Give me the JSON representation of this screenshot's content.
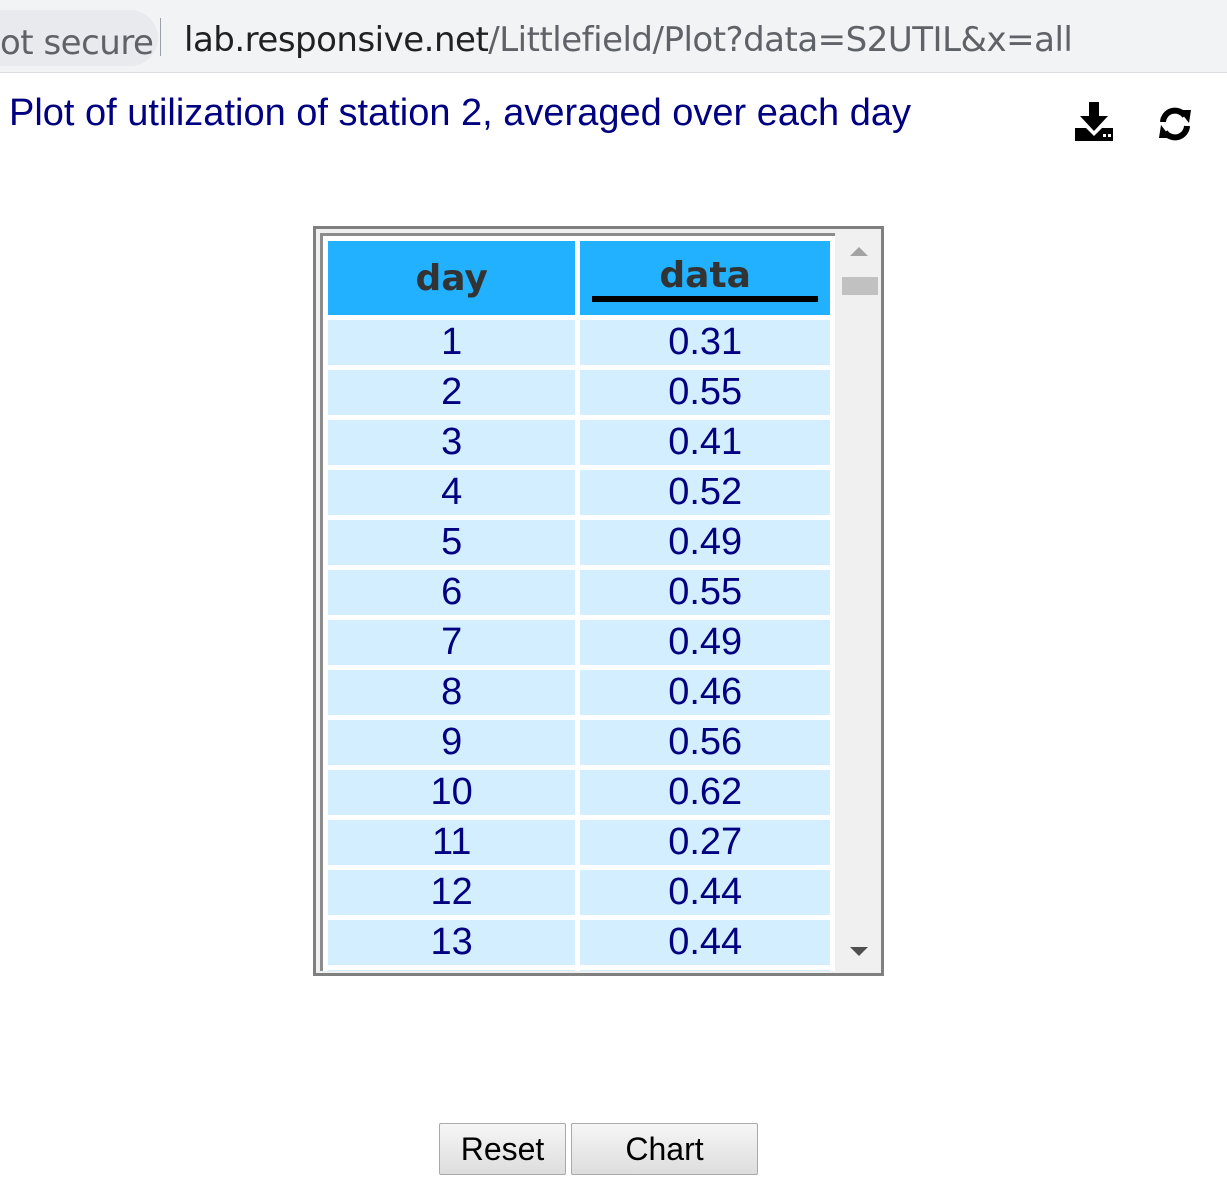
{
  "browser": {
    "security_label": "ot secure",
    "url_host": "lab.responsive.net",
    "url_path": "/Littlefield/Plot?data=S2UTIL&x=all"
  },
  "page": {
    "title": "Plot of utilization of station 2, averaged over each day",
    "download_icon": "download-icon",
    "refresh_icon": "refresh-icon"
  },
  "table": {
    "columns": [
      "day",
      "data"
    ],
    "sorted_column": "data",
    "rows": [
      [
        "1",
        "0.31"
      ],
      [
        "2",
        "0.55"
      ],
      [
        "3",
        "0.41"
      ],
      [
        "4",
        "0.52"
      ],
      [
        "5",
        "0.49"
      ],
      [
        "6",
        "0.55"
      ],
      [
        "7",
        "0.49"
      ],
      [
        "8",
        "0.46"
      ],
      [
        "9",
        "0.56"
      ],
      [
        "10",
        "0.62"
      ],
      [
        "11",
        "0.27"
      ],
      [
        "12",
        "0.44"
      ],
      [
        "13",
        "0.44"
      ],
      [
        "",
        ""
      ]
    ],
    "header_color": "#22b1ff",
    "cell_color": "#d2eeff",
    "text_color": "#000080"
  },
  "buttons": {
    "reset": "Reset",
    "chart": "Chart"
  }
}
